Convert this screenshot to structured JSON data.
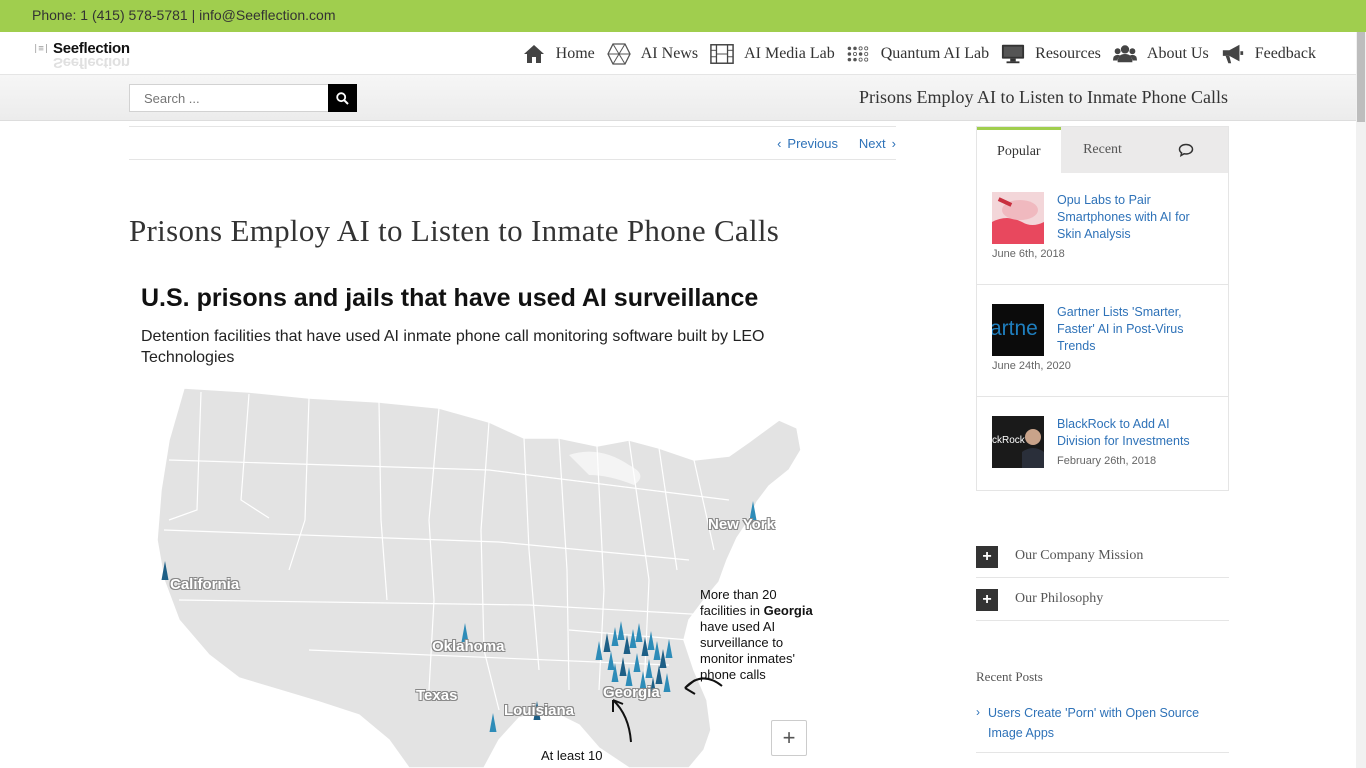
{
  "topbar": {
    "contact": "Phone: 1 (415) 578-5781 | info@Seeflection.com"
  },
  "logo": {
    "mark": "|≡|",
    "text": "Seeflection"
  },
  "nav": [
    {
      "label": "Home",
      "icon": "home-icon"
    },
    {
      "label": "AI News",
      "icon": "hexagon-icon"
    },
    {
      "label": "AI Media Lab",
      "icon": "film-icon"
    },
    {
      "label": "Quantum AI Lab",
      "icon": "dots-grid-icon"
    },
    {
      "label": "Resources",
      "icon": "desktop-icon"
    },
    {
      "label": "About Us",
      "icon": "users-icon"
    },
    {
      "label": "Feedback",
      "icon": "bullhorn-icon"
    }
  ],
  "search": {
    "placeholder": "Search ..."
  },
  "page_title": "Prisons Employ AI to Listen to Inmate Phone Calls",
  "post_nav": {
    "previous": "Previous",
    "next": "Next"
  },
  "post": {
    "title": "Prisons Employ AI to Listen to Inmate Phone Calls",
    "figure": {
      "title": "U.S. prisons and jails that have used AI surveillance",
      "subtitle": "Detention facilities that have used AI inmate phone call monitoring software built by LEO Technologies",
      "labels": {
        "california": "California",
        "oklahoma": "Oklahoma",
        "texas": "Texas",
        "louisiana": "Louisiana",
        "georgia": "Georgia",
        "new_york": "New York"
      },
      "annotation_georgia_pre": "More than 20 facilities in",
      "annotation_georgia_bold": "Georgia",
      "annotation_georgia_post": "have used AI surveillance to monitor inmates' phone calls",
      "annotation_bottom": "At least 10",
      "zoom_in": "+"
    }
  },
  "sidebar": {
    "tabs": [
      {
        "label": "Popular",
        "active": true
      },
      {
        "label": "Recent",
        "active": false
      },
      {
        "label": "",
        "icon": "comments-icon",
        "active": false
      }
    ],
    "popular": [
      {
        "title": "Opu Labs to Pair Smartphones with AI for Skin Analysis",
        "date": "June 6th, 2018"
      },
      {
        "title": "Gartner Lists 'Smarter, Faster' AI in Post-Virus Trends",
        "date": "June 24th, 2020",
        "thumb_text": "artne"
      },
      {
        "title": "BlackRock to Add AI Division for Investments",
        "date": "February 26th, 2018",
        "thumb_text": "ckRock"
      }
    ],
    "toggles": [
      {
        "label": "Our Company Mission",
        "symbol": "+"
      },
      {
        "label": "Our Philosophy",
        "symbol": "+"
      }
    ],
    "recent_posts": {
      "heading": "Recent Posts",
      "items": [
        {
          "title": "Users Create 'Porn' with Open Source Image Apps"
        }
      ]
    }
  },
  "colors": {
    "accent": "#a0ce4e",
    "link": "#2e72b8",
    "marker": "#2e7fa8"
  }
}
